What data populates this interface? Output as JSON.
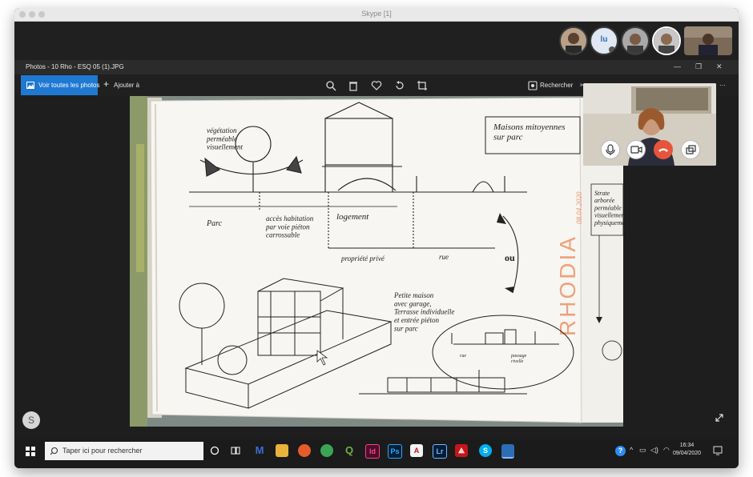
{
  "mac_window": {
    "title": "Skype [1]"
  },
  "photos": {
    "title": "Photos - 10 Rho - ESQ 05 (1).JPG",
    "toolbar": {
      "see_all": "Voir toutes les photos",
      "add_to": "Ajouter à",
      "search": "Rechercher"
    }
  },
  "participants": {
    "initials": "lu"
  },
  "sketch": {
    "label_maisons": "Maisons mitoyennes\nsur parc",
    "label_vegetation": "végétation\nperméable\nvisuellement",
    "label_parc": "Parc",
    "label_acces": "accès habitation\npar voie piéton\ncarrossable",
    "label_logement": "logement",
    "label_propriete": "propriété privé",
    "label_rue": "rue",
    "label_ou": "ou",
    "label_petite": "Petite maison\navec garage,\nTerrasse individuelle\net entrée piéton\nsur parc",
    "label_rue2": "rue",
    "label_passage": "passage\nrivelle",
    "label_rhodia": "RHODIA",
    "label_date": "08.04.2020",
    "label_strate": "Strate\narborée\nperméable\nvisuellement\nphysiquement"
  },
  "taskbar": {
    "search_placeholder": "Taper ici pour rechercher",
    "time": "16:34",
    "date": "09/04/2020",
    "skype_letter": "S"
  },
  "colors": {
    "accent": "#1f78d1",
    "hangup": "#e8543b",
    "orange_ink": "#f0a07a"
  }
}
